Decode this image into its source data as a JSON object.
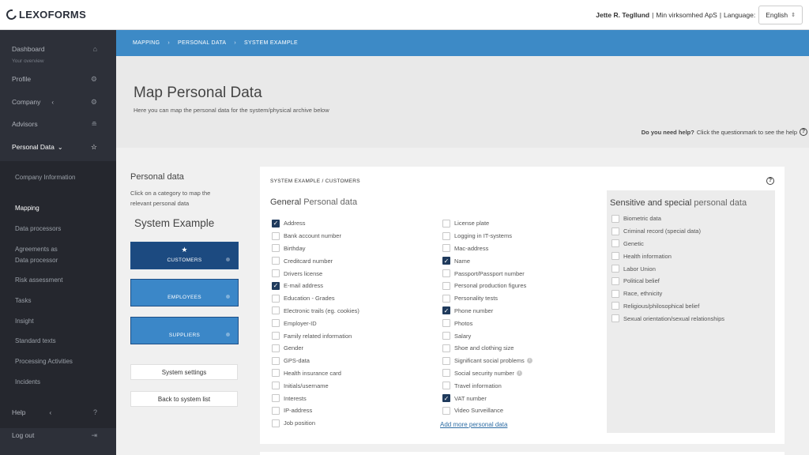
{
  "topbar": {
    "logo": "LEXOFORMS",
    "user_name": "Jette R. Tegllund",
    "company": "Min virksomhed ApS",
    "language_label": "Language:",
    "language_value": "English"
  },
  "sidebar": {
    "items": [
      {
        "label": "Dashboard",
        "icon": "home-icon"
      },
      {
        "label": "Profile",
        "icon": "gear-icon"
      },
      {
        "label": "Company",
        "icon": "gear-icon"
      },
      {
        "label": "Advisors",
        "icon": "graduation-cap-icon"
      },
      {
        "label": "Personal Data",
        "icon": "star-icon"
      }
    ],
    "dashboard_caption": "Your overview",
    "sub_items": [
      "Company Information",
      "Mapping",
      "Data processors",
      "Agreements as Data processor",
      "Risk assessment",
      "Tasks",
      "Insight",
      "Standard texts",
      "Processing Activities",
      "Incidents"
    ],
    "active_sub": "Mapping",
    "bottom": [
      {
        "label": "Help",
        "icon": "question-icon"
      },
      {
        "label": "Log out",
        "icon": "logout-icon"
      }
    ]
  },
  "breadcrumb": [
    "MAPPING",
    "PERSONAL DATA",
    "SYSTEM EXAMPLE"
  ],
  "header": {
    "title": "Map Personal Data",
    "subtitle": "Here you can map the personal data for the system/physical archive below",
    "help_bold": "Do you need help?",
    "help_text": "Click the questionmark to see the help"
  },
  "left_panel": {
    "title": "Personal data",
    "description": "Click on a category to map the relevant personal data",
    "system_name": "System Example",
    "categories": [
      "CUSTOMERS",
      "EMPLOYEES",
      "SUPPLIERS"
    ],
    "selected_category": "CUSTOMERS",
    "system_settings": "System settings",
    "back": "Back to system list"
  },
  "card": {
    "heading": "SYSTEM EXAMPLE / CUSTOMERS",
    "general_title_a": "General",
    "general_title_b": "Personal data",
    "col1": [
      {
        "label": "Address",
        "checked": true
      },
      {
        "label": "Bank account number",
        "checked": false
      },
      {
        "label": "Birthday",
        "checked": false
      },
      {
        "label": "Creditcard number",
        "checked": false
      },
      {
        "label": "Drivers license",
        "checked": false
      },
      {
        "label": "E-mail address",
        "checked": true
      },
      {
        "label": "Education - Grades",
        "checked": false
      },
      {
        "label": "Electronic trails (eg. cookies)",
        "checked": false
      },
      {
        "label": "Employer-ID",
        "checked": false
      },
      {
        "label": "Family related information",
        "checked": false
      },
      {
        "label": "Gender",
        "checked": false
      },
      {
        "label": "GPS-data",
        "checked": false
      },
      {
        "label": "Health insurance card",
        "checked": false
      },
      {
        "label": "Initials/username",
        "checked": false
      },
      {
        "label": "Interests",
        "checked": false
      },
      {
        "label": "IP-address",
        "checked": false
      },
      {
        "label": "Job position",
        "checked": false
      }
    ],
    "col2": [
      {
        "label": "License plate",
        "checked": false
      },
      {
        "label": "Logging in IT-systems",
        "checked": false
      },
      {
        "label": "Mac-address",
        "checked": false
      },
      {
        "label": "Name",
        "checked": true
      },
      {
        "label": "Passport/Passport number",
        "checked": false
      },
      {
        "label": "Personal production figures",
        "checked": false
      },
      {
        "label": "Personality tests",
        "checked": false
      },
      {
        "label": "Phone number",
        "checked": true
      },
      {
        "label": "Photos",
        "checked": false
      },
      {
        "label": "Salary",
        "checked": false
      },
      {
        "label": "Shoe and clothing size",
        "checked": false
      },
      {
        "label": "Significant social problems",
        "checked": false,
        "info": true
      },
      {
        "label": "Social security number",
        "checked": false,
        "info": true
      },
      {
        "label": "Travel information",
        "checked": false
      },
      {
        "label": "VAT number",
        "checked": true
      },
      {
        "label": "Video Surveillance",
        "checked": false
      }
    ],
    "add_more": "Add more personal data",
    "sensitive_title_a": "Sensitive and special",
    "sensitive_title_b": "personal data",
    "sensitive": [
      {
        "label": "Biometric data",
        "checked": false
      },
      {
        "label": "Criminal record (special data)",
        "checked": false
      },
      {
        "label": "Genetic",
        "checked": false
      },
      {
        "label": "Health information",
        "checked": false
      },
      {
        "label": "Labor Union",
        "checked": false
      },
      {
        "label": "Political belief",
        "checked": false
      },
      {
        "label": "Race, ethnicity",
        "checked": false
      },
      {
        "label": "Religious/philosophical belief",
        "checked": false
      },
      {
        "label": "Sexual orientation/sexual relationships",
        "checked": false
      }
    ]
  },
  "colors": {
    "sidebar": "#2d3039",
    "breadcrumb": "#3d8ac6",
    "selected_category": "#1c4a80",
    "category": "#3b87c8",
    "checkbox_checked": "#1f3a5c"
  }
}
